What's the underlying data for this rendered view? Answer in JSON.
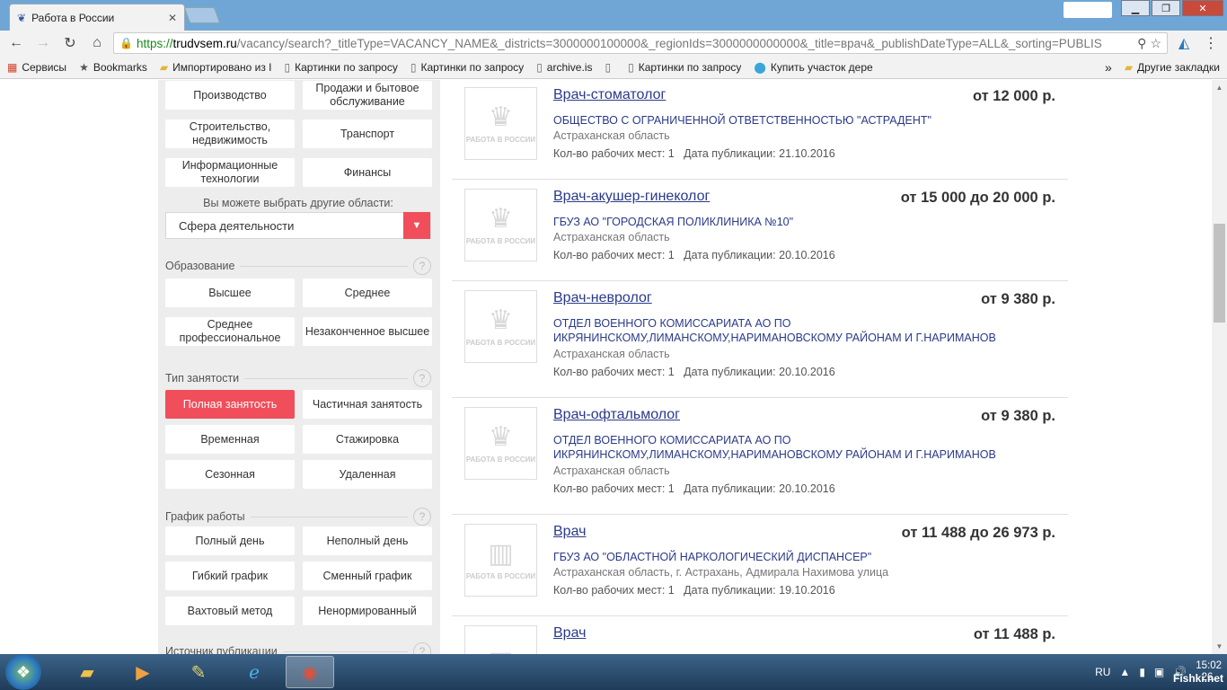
{
  "browser": {
    "tab_title": "Работа в России",
    "url_proto": "https://",
    "url_host": "trudvsem.ru",
    "url_path": "/vacancy/search?_titleType=VACANCY_NAME&_districts=3000000100000&_regionIds=3000000000000&_title=врач&_publishDateType=ALL&_sorting=PUBLIS",
    "bookmarks": [
      {
        "label": "Сервисы",
        "icon": "apps-icon"
      },
      {
        "label": "Bookmarks",
        "icon": "star-icon"
      },
      {
        "label": "Импортировано из I",
        "icon": "folder-icon"
      },
      {
        "label": "Картинки по запросу",
        "icon": "page-icon"
      },
      {
        "label": "Картинки по запросу",
        "icon": "page-icon"
      },
      {
        "label": "archive.is",
        "icon": "page-icon"
      },
      {
        "label": "",
        "icon": "page-icon"
      },
      {
        "label": "Картинки по запросу",
        "icon": "page-icon"
      },
      {
        "label": "Купить участок дере",
        "icon": "pin-icon"
      }
    ],
    "more_bookmarks": "»",
    "other_bookmarks": "Другие закладки"
  },
  "filters": {
    "industry_chips": [
      "Производство",
      "Продажи и бытовое обслуживание",
      "Строительство, недвижимость",
      "Транспорт",
      "Информационные технологии",
      "Финансы"
    ],
    "other_hint": "Вы можете выбрать другие области:",
    "select_value": "Сфера деятельности",
    "education": {
      "label": "Образование",
      "chips": [
        "Высшее",
        "Среднее",
        "Среднее профессиональное",
        "Незаконченное высшее"
      ]
    },
    "employment": {
      "label": "Тип занятости",
      "chips": [
        "Полная занятость",
        "Частичная занятость",
        "Временная",
        "Стажировка",
        "Сезонная",
        "Удаленная"
      ],
      "active_index": 0
    },
    "schedule": {
      "label": "График работы",
      "chips": [
        "Полный день",
        "Неполный день",
        "Гибкий график",
        "Сменный график",
        "Вахтовый метод",
        "Ненормированный"
      ]
    },
    "source": {
      "label": "Источник публикации"
    },
    "help": "?"
  },
  "vacancies": [
    {
      "title": "Врач-стоматолог",
      "salary": "от 12 000 р.",
      "company": "ОБЩЕСТВО С ОГРАНИЧЕННОЙ ОТВЕТСТВЕННОСТЬЮ \"АСТРАДЕНТ\"",
      "region": "Астраханская область",
      "places_label": "Кол-во рабочих мест:",
      "places": "1",
      "date_label": "Дата публикации:",
      "date": "21.10.2016",
      "logo_text": "РАБОТА В РОССИИ",
      "logo": "emblem"
    },
    {
      "title": "Врач-акушер-гинеколог",
      "salary": "от 15 000 до 20 000 р.",
      "company": "ГБУЗ АО \"ГОРОДСКАЯ ПОЛИКЛИНИКА №10\"",
      "region": "Астраханская область",
      "places_label": "Кол-во рабочих мест:",
      "places": "1",
      "date_label": "Дата публикации:",
      "date": "20.10.2016",
      "logo_text": "РАБОТА В РОССИИ",
      "logo": "emblem"
    },
    {
      "title": "Врач-невролог",
      "salary": "от 9 380 р.",
      "company": "ОТДЕЛ ВОЕННОГО КОМИССАРИАТА АО ПО ИКРЯНИНСКОМУ,ЛИМАНСКОМУ,НАРИМАНОВСКОМУ РАЙОНАМ И Г.НАРИМАНОВ",
      "region": "Астраханская область",
      "places_label": "Кол-во рабочих мест:",
      "places": "1",
      "date_label": "Дата публикации:",
      "date": "20.10.2016",
      "logo_text": "РАБОТА В РОССИИ",
      "logo": "emblem"
    },
    {
      "title": "Врач-офтальмолог",
      "salary": "от 9 380 р.",
      "company": "ОТДЕЛ ВОЕННОГО КОМИССАРИАТА АО ПО ИКРЯНИНСКОМУ,ЛИМАНСКОМУ,НАРИМАНОВСКОМУ РАЙОНАМ И Г.НАРИМАНОВ",
      "region": "Астраханская область",
      "places_label": "Кол-во рабочих мест:",
      "places": "1",
      "date_label": "Дата публикации:",
      "date": "20.10.2016",
      "logo_text": "РАБОТА В РОССИИ",
      "logo": "emblem"
    },
    {
      "title": "Врач",
      "salary": "от 11 488 до 26 973 р.",
      "company": "ГБУЗ АО \"ОБЛАСТНОЙ НАРКОЛОГИЧЕСКИЙ ДИСПАНСЕР\"",
      "region": "Астраханская область, г. Астрахань, Адмирала Нахимова улица",
      "places_label": "Кол-во рабочих мест:",
      "places": "1",
      "date_label": "Дата публикации:",
      "date": "19.10.2016",
      "logo_text": "РАБОТА В РОССИИ",
      "logo": "building"
    },
    {
      "title": "Врач",
      "salary": "от 11 488 р.",
      "company": "",
      "region": "",
      "places_label": "",
      "places": "",
      "date_label": "",
      "date": "",
      "logo_text": "",
      "logo": "building"
    }
  ],
  "taskbar": {
    "lang": "RU",
    "time": "15:02",
    "date": "26.",
    "watermark": "Fishki.net"
  }
}
